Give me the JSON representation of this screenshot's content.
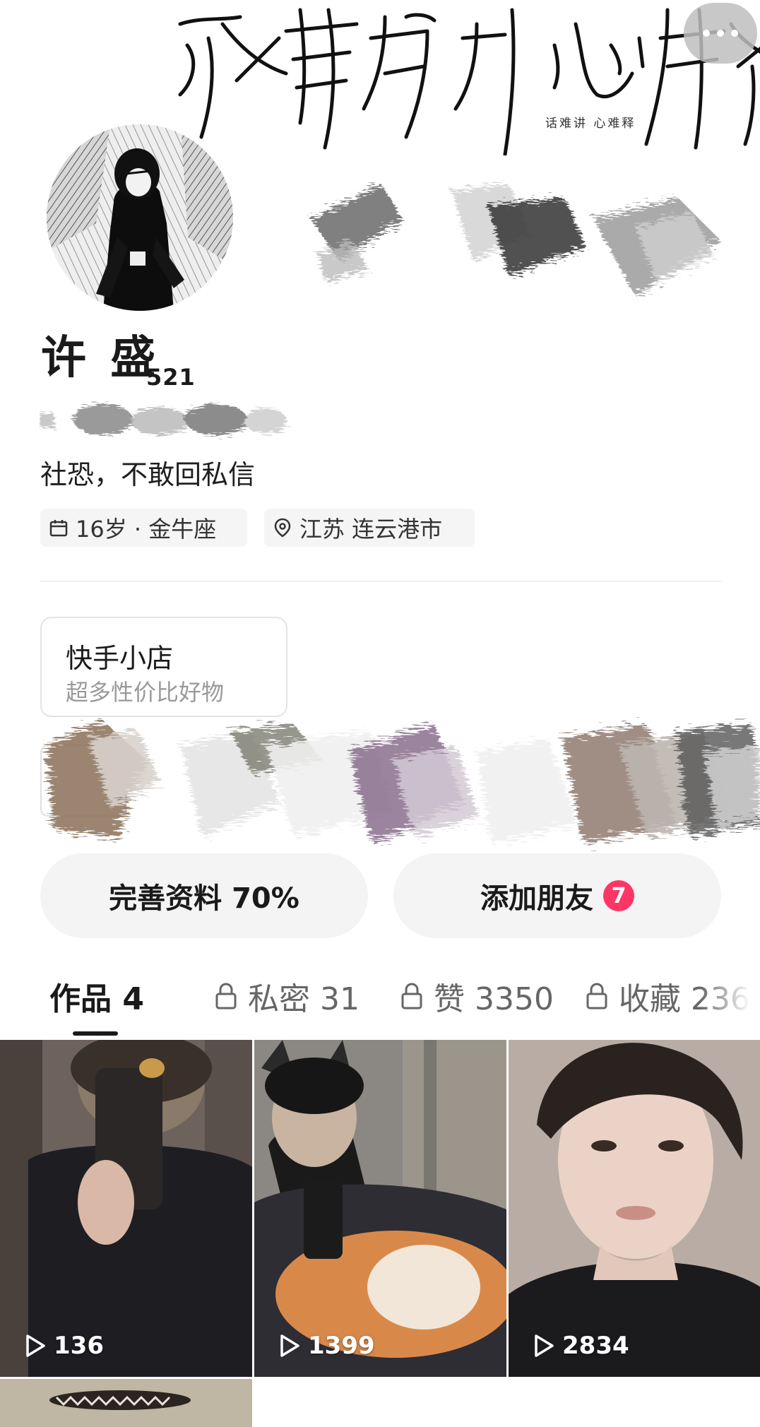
{
  "banner": {
    "calligraphy_text": "话难讲 心难释",
    "caption": "话难讲 心难释"
  },
  "profile": {
    "name": "许 盛",
    "name_suffix": "521",
    "bio": "社恐，不敢回私信",
    "age_tag": "16岁 · 金牛座",
    "location_tag": "江苏 连云港市"
  },
  "shop": {
    "title": "快手小店",
    "subtitle": "超多性价比好物"
  },
  "actions": {
    "complete_profile": "完善资料 70%",
    "add_friends": "添加朋友",
    "add_friends_badge": "7"
  },
  "tabs": [
    {
      "label": "作品 4",
      "locked": false,
      "active": true
    },
    {
      "label": "私密 31",
      "locked": true,
      "active": false
    },
    {
      "label": "赞 3350",
      "locked": true,
      "active": false
    },
    {
      "label": "收藏 236",
      "locked": true,
      "active": false
    }
  ],
  "videos": [
    {
      "views": "136"
    },
    {
      "views": "1399"
    },
    {
      "views": "2834"
    }
  ],
  "icons": {
    "more": "more-dots-icon",
    "calendar": "calendar-icon",
    "location": "location-pin-icon",
    "lock": "lock-icon",
    "play": "play-icon"
  },
  "colors": {
    "badge": "#fe3666",
    "button_bg": "#f4f4f4",
    "tag_bg": "#f5f5f5"
  }
}
